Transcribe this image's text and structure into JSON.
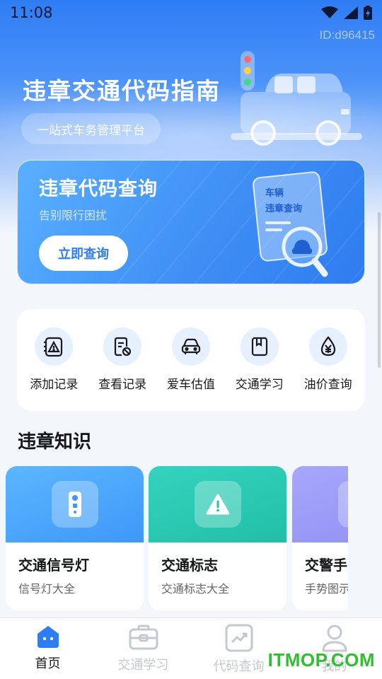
{
  "status_bar": {
    "time": "11:08"
  },
  "watermark_id": "ID:d96415",
  "hero": {
    "title": "违章交通代码指南",
    "subtitle": "一站式车务管理平台"
  },
  "query_banner": {
    "title": "违章代码查询",
    "subtitle": "告别限行困扰",
    "button": "立即查询",
    "art_text_1": "车辆",
    "art_text_2": "违章查询"
  },
  "quick_actions": [
    {
      "label": "添加记录",
      "icon": "warning-doc-icon"
    },
    {
      "label": "查看记录",
      "icon": "doc-search-icon"
    },
    {
      "label": "爱车估值",
      "icon": "car-icon"
    },
    {
      "label": "交通学习",
      "icon": "book-icon"
    },
    {
      "label": "油价查询",
      "icon": "oil-yuan-icon"
    }
  ],
  "section_title": "违章知识",
  "knowledge_cards": [
    {
      "title": "交通信号灯",
      "subtitle": "信号灯大全",
      "color": "#4aa8fb",
      "icon": "traffic-light-icon"
    },
    {
      "title": "交通标志",
      "subtitle": "交通标志大全",
      "color": "#2ec9b4",
      "icon": "warning-sign-icon"
    },
    {
      "title": "交警手",
      "subtitle": "手势图示",
      "color": "#9b9cf7",
      "icon": "hand-icon"
    }
  ],
  "bottom_nav": [
    {
      "label": "首页",
      "icon": "home-icon",
      "active": true
    },
    {
      "label": "交通学习",
      "icon": "briefcase-icon",
      "active": false
    },
    {
      "label": "代码查询",
      "icon": "chart-icon",
      "active": false
    },
    {
      "label": "我的",
      "icon": "user-icon",
      "active": false
    }
  ],
  "site_watermark": "ITMOP.COM",
  "colors": {
    "primary": "#2f7df6",
    "teal": "#2ec9b4",
    "purple": "#9b9cf7"
  }
}
